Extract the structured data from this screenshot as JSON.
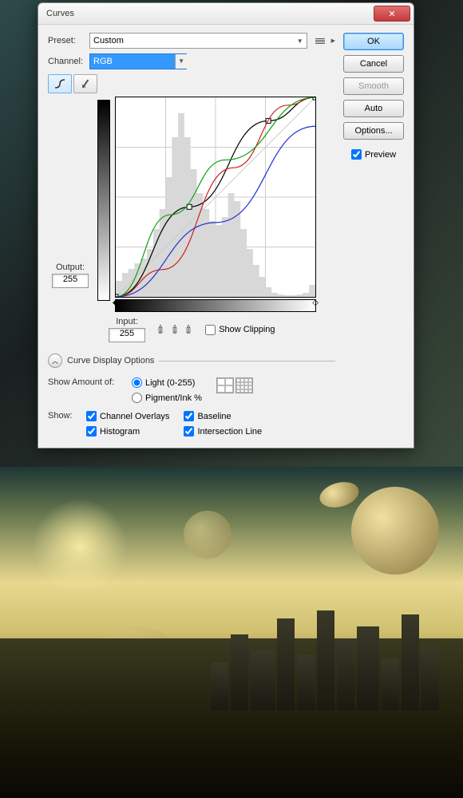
{
  "dialog": {
    "title": "Curves",
    "preset_label": "Preset:",
    "preset_value": "Custom",
    "channel_label": "Channel:",
    "channel_value": "RGB",
    "output_label": "Output:",
    "output_value": "255",
    "input_label": "Input:",
    "input_value": "255",
    "show_clipping": "Show Clipping",
    "display_options": "Curve Display Options",
    "show_amount_label": "Show Amount of:",
    "light_label": "Light  (0-255)",
    "pigment_label": "Pigment/Ink %",
    "show_label": "Show:",
    "cb_overlays": "Channel Overlays",
    "cb_baseline": "Baseline",
    "cb_histogram": "Histogram",
    "cb_intersection": "Intersection Line"
  },
  "buttons": {
    "ok": "OK",
    "cancel": "Cancel",
    "smooth": "Smooth",
    "auto": "Auto",
    "options": "Options...",
    "preview": "Preview"
  },
  "chart_data": {
    "type": "line",
    "title": "Curves",
    "xlabel": "Input",
    "ylabel": "Output",
    "xlim": [
      0,
      255
    ],
    "ylim": [
      0,
      255
    ],
    "grid": true,
    "series": [
      {
        "name": "RGB",
        "color": "#000000",
        "points": [
          [
            0,
            0
          ],
          [
            94,
            115
          ],
          [
            195,
            225
          ],
          [
            255,
            255
          ]
        ]
      },
      {
        "name": "Red",
        "color": "#d02020",
        "points": [
          [
            0,
            0
          ],
          [
            60,
            35
          ],
          [
            150,
            165
          ],
          [
            220,
            245
          ],
          [
            255,
            255
          ]
        ]
      },
      {
        "name": "Green",
        "color": "#10a010",
        "points": [
          [
            0,
            0
          ],
          [
            70,
            105
          ],
          [
            140,
            175
          ],
          [
            255,
            255
          ]
        ]
      },
      {
        "name": "Blue",
        "color": "#2030d0",
        "points": [
          [
            0,
            0
          ],
          [
            128,
            95
          ],
          [
            255,
            218
          ]
        ]
      }
    ],
    "histogram": [
      20,
      30,
      35,
      42,
      48,
      60,
      85,
      110,
      150,
      200,
      230,
      200,
      160,
      130,
      110,
      95,
      90,
      100,
      130,
      120,
      85,
      60,
      40,
      25,
      12,
      5,
      3,
      2,
      2,
      3,
      5,
      15
    ]
  }
}
